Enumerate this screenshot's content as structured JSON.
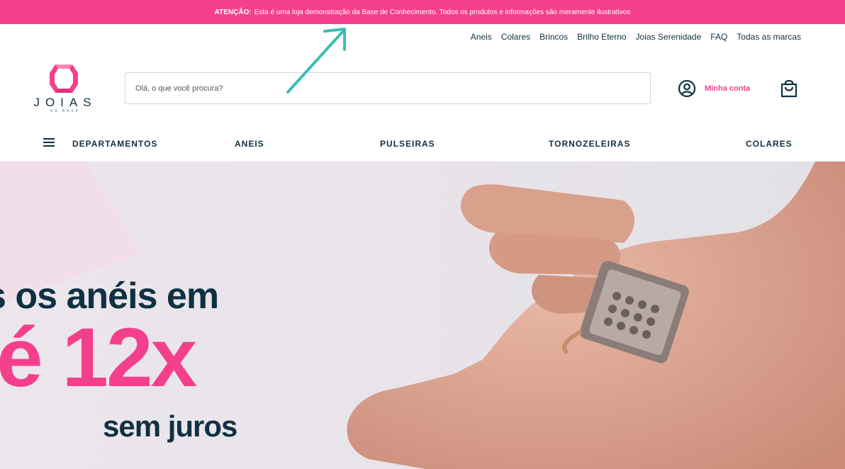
{
  "announcement": {
    "bold": "ATENÇÃO:",
    "text": "Esta é uma loja demonstração da Base de Conhecimento. Todos os produtos e informações são meramente ilustrativos"
  },
  "top_links": [
    "Aneis",
    "Colares",
    "Brincos",
    "Brilho Eterno",
    "Joias Serenidade",
    "FAQ",
    "Todas as marcas"
  ],
  "logo": {
    "name": "JOIAS",
    "subtitle": "DA BASE"
  },
  "search": {
    "placeholder": "Olá, o que você procura?",
    "value": ""
  },
  "account": {
    "label": "Minha conta"
  },
  "nav": {
    "menu_icon": "hamburger-icon",
    "items": [
      "DEPARTAMENTOS",
      "ANEIS",
      "PULSEIRAS",
      "TORNOZELEIRAS",
      "COLARES"
    ]
  },
  "hero": {
    "line1": "s os anéis em",
    "line2": "é 12x",
    "line3": "sem juros"
  },
  "colors": {
    "brand_pink": "#f43f8c",
    "navy": "#0f3142",
    "annotation_arrow": "#3bbfb4"
  }
}
